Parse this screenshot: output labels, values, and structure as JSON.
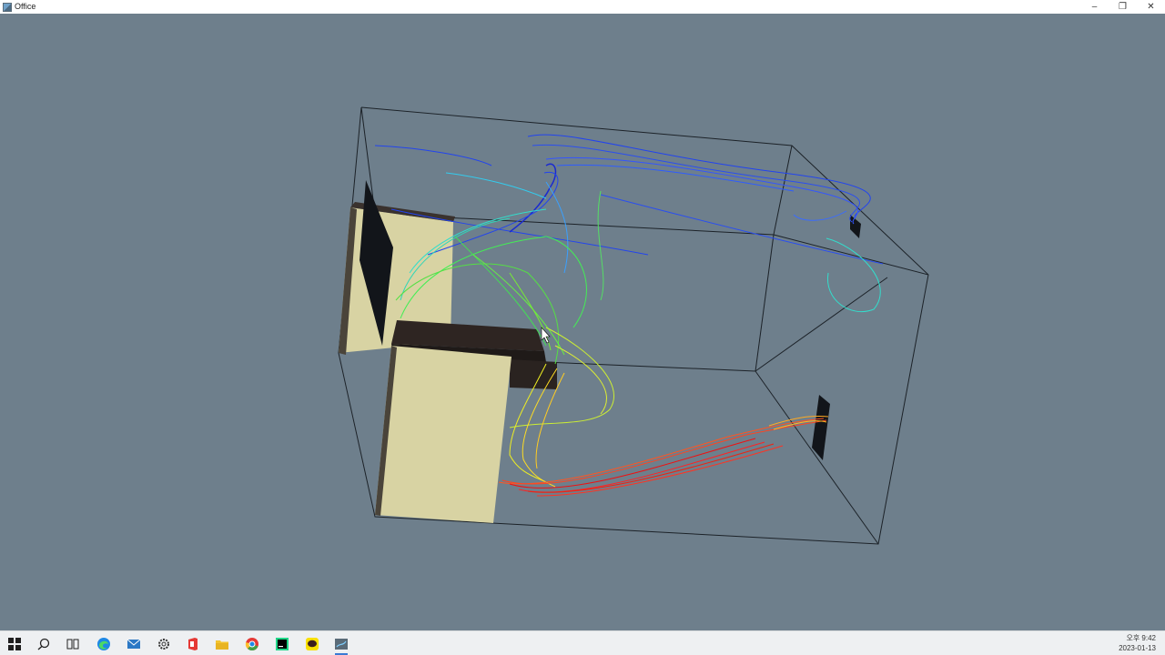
{
  "window": {
    "title": "Office",
    "controls": {
      "minimize": "–",
      "maximize": "❐",
      "close": "✕"
    }
  },
  "scene": {
    "background": "#6e7f8c",
    "block_color": "#d8d3a3",
    "desk_color": "#2e2522",
    "streamline_colors": [
      "#2244ee",
      "#3aa0ff",
      "#33ddcc",
      "#44ee55",
      "#ccee33",
      "#ffcc22",
      "#ff5522",
      "#ee1111"
    ]
  },
  "taskbar": {
    "icons": [
      "windows-start-icon",
      "search-icon",
      "task-view-icon",
      "edge-browser-icon",
      "mail-icon",
      "settings-icon",
      "office-icon",
      "file-explorer-icon",
      "chrome-icon",
      "pycharm-icon",
      "kakaotalk-icon",
      "office-sim-app-icon"
    ],
    "clock": {
      "time": "오후 9:42",
      "date": "2023-01-13"
    }
  }
}
